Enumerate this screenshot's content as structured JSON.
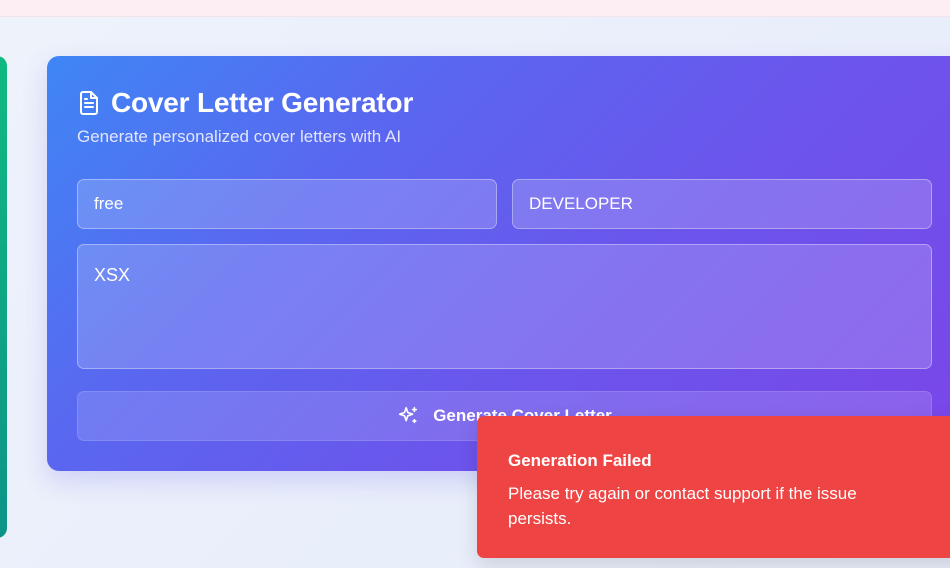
{
  "card": {
    "title": "Cover Letter Generator",
    "subtitle": "Generate personalized cover letters with AI",
    "company_value": "free",
    "position_value": "DEVELOPER",
    "details_value": "XSX",
    "generate_label": "Generate Cover Letter"
  },
  "toast": {
    "title": "Generation Failed",
    "message": "Please try again or contact support if the issue persists."
  },
  "icons": {
    "title_icon": "document-icon",
    "button_icon": "sparkles-icon"
  },
  "colors": {
    "card_gradient_start": "#3f86f5",
    "card_gradient_end": "#7b45e8",
    "toast_bg": "#ef4444",
    "left_card": "#10b981"
  }
}
